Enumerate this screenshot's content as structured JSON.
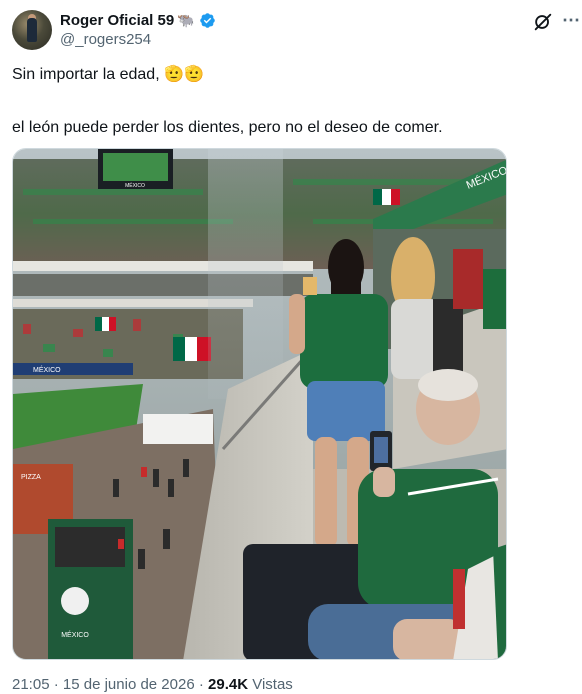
{
  "author": {
    "display_name": "Roger Oficial 59",
    "badge_emoji": "🐃",
    "handle": "@_rogers254",
    "verified": true,
    "verified_color": "#1d9bf0"
  },
  "tweet": {
    "line1": "Sin importar la edad, 🫡🫡",
    "line2": "el león puede perder los dientes, pero no el deseo de comer."
  },
  "meta": {
    "time": "21:05",
    "sep1": " · ",
    "date": "15 de junio de 2026",
    "sep2": " · ",
    "views": "29.4K",
    "views_label": " Vistas"
  },
  "icons": {
    "grok": "grok-icon",
    "more": "more-icon",
    "verified": "verified-badge-icon"
  },
  "photo": {
    "stadium_banner": "MÉXICO",
    "ad_board_1": "MÉXICO",
    "scoreboard": "MÉXICO",
    "stand_label": "MÉXICO",
    "vendor_sign": "PIZZA"
  }
}
